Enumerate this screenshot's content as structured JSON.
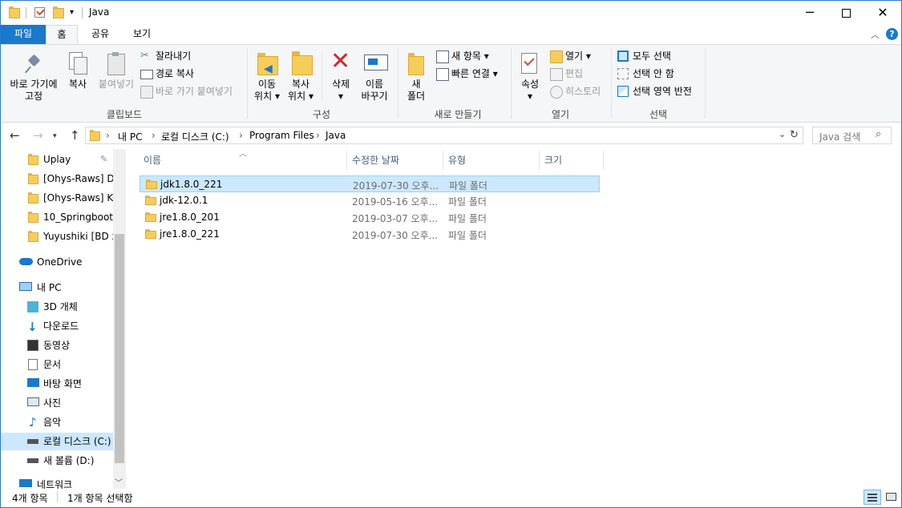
{
  "window": {
    "title": "Java"
  },
  "ribbon_tabs": {
    "file": "파일",
    "home": "홈",
    "share": "공유",
    "view": "보기"
  },
  "clipboard": {
    "pin": [
      "바로 가기에",
      "고정"
    ],
    "copy": "복사",
    "paste": "붙여넣기",
    "cut": "잘라내기",
    "copy_path": "경로 복사",
    "paste_shortcut": "바로 가기 붙여넣기",
    "label": "클립보드"
  },
  "organize": {
    "move": [
      "이동",
      "위치"
    ],
    "copy_to": [
      "복사",
      "위치"
    ],
    "delete": "삭제",
    "rename": [
      "이름",
      "바꾸기"
    ],
    "label": "구성"
  },
  "new_group": {
    "new_folder": [
      "새",
      "폴더"
    ],
    "new_item": "새 항목",
    "easy_access": "빠른 연결",
    "label": "새로 만들기"
  },
  "open_group": {
    "properties": "속성",
    "open": "열기",
    "edit": "편집",
    "history": "히스토리",
    "label": "열기"
  },
  "select_group": {
    "select_all": "모두 선택",
    "select_none": "선택 안 함",
    "invert": "선택 영역 반전",
    "label": "선택"
  },
  "address": {
    "crumbs": [
      "내 PC",
      "로컬 디스크 (C:)",
      "Program Files",
      "Java"
    ],
    "search_placeholder": "Java 검색"
  },
  "nav_pane": {
    "quick": [
      "Uplay",
      "[Ohys-Raws] Du",
      "[Ohys-Raws] Kar",
      "10_Springboot",
      "Yuyushiki [BD x"
    ],
    "onedrive": "OneDrive",
    "thispc": "내 PC",
    "pc_items": [
      "3D 개체",
      "다운로드",
      "동영상",
      "문서",
      "바탕 화면",
      "사진",
      "음악",
      "로컬 디스크 (C:)",
      "새 볼륨 (D:)"
    ],
    "network": "네트워크"
  },
  "columns": {
    "name": "이름",
    "modified": "수정한 날짜",
    "type": "유형",
    "size": "크기"
  },
  "files": [
    {
      "name": "jdk1.8.0_221",
      "modified": "2019-07-30 오후...",
      "type": "파일 폴더"
    },
    {
      "name": "jdk-12.0.1",
      "modified": "2019-05-16 오후...",
      "type": "파일 폴더"
    },
    {
      "name": "jre1.8.0_201",
      "modified": "2019-03-07 오후...",
      "type": "파일 폴더"
    },
    {
      "name": "jre1.8.0_221",
      "modified": "2019-07-30 오후...",
      "type": "파일 폴더"
    }
  ],
  "status": {
    "count": "4개 항목",
    "selected": "1개 항목 선택함"
  },
  "colors": {
    "accent": "#1979ca",
    "selection": "#cce8ff",
    "folder": "#f7cd5a"
  }
}
